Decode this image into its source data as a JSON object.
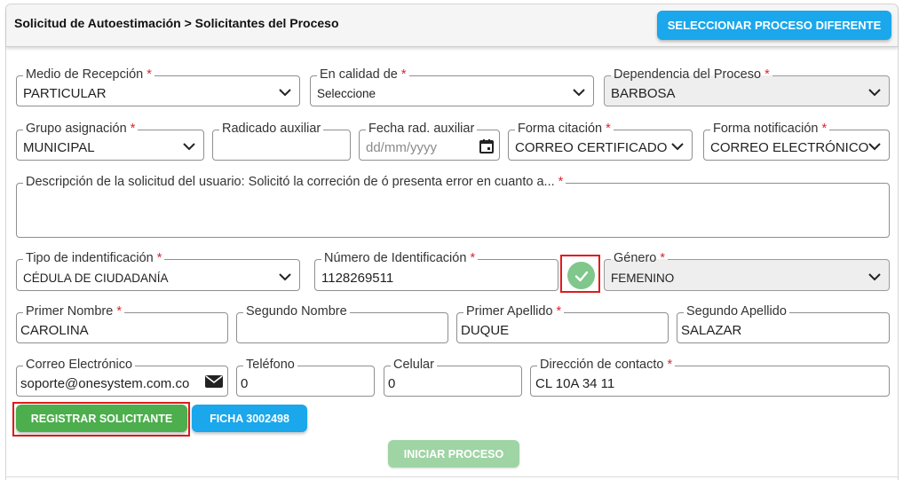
{
  "header": {
    "breadcrumb": "Solicitud de Autoestimación > Solicitantes del Proceso",
    "select_other_process": "SELECCIONAR PROCESO DIFERENTE"
  },
  "form": {
    "medio_recepcion": {
      "label": "Medio de Recepción",
      "required": "*",
      "value": "PARTICULAR"
    },
    "en_calidad_de": {
      "label": "En calidad de",
      "required": "*",
      "value": "Seleccione"
    },
    "dependencia_proceso": {
      "label": "Dependencia del Proceso",
      "required": "*",
      "value": "BARBOSA"
    },
    "grupo_asignacion": {
      "label": "Grupo asignación",
      "required": "*",
      "value": "MUNICIPAL"
    },
    "radicado_auxiliar": {
      "label": "Radicado auxiliar",
      "value": ""
    },
    "fecha_rad_auxiliar": {
      "label": "Fecha rad. auxiliar",
      "placeholder": "dd/mm/yyyy"
    },
    "forma_citacion": {
      "label": "Forma citación",
      "required": "*",
      "value": "CORREO CERTIFICADO"
    },
    "forma_notificacion": {
      "label": "Forma notificación",
      "required": "*",
      "value": "CORREO ELECTRÓNICO"
    },
    "descripcion": {
      "label": "Descripción de la solicitud del usuario: Solicitó la correción de ó presenta error en cuanto a...",
      "required": "*",
      "value": ""
    },
    "tipo_identificacion": {
      "label": "Tipo de indentificación",
      "required": "*",
      "value": "CÉDULA DE CIUDADANÍA"
    },
    "numero_identificacion": {
      "label": "Número de Identificación",
      "required": "*",
      "value": "1128269511"
    },
    "genero": {
      "label": "Género",
      "required": "*",
      "value": "FEMENINO"
    },
    "primer_nombre": {
      "label": "Primer Nombre",
      "required": "*",
      "value": "CAROLINA"
    },
    "segundo_nombre": {
      "label": "Segundo Nombre",
      "value": ""
    },
    "primer_apellido": {
      "label": "Primer Apellido",
      "required": "*",
      "value": "DUQUE"
    },
    "segundo_apellido": {
      "label": "Segundo Apellido",
      "value": "SALAZAR"
    },
    "correo": {
      "label": "Correo Electrónico",
      "value": "soporte@onesystem.com.co"
    },
    "telefono": {
      "label": "Teléfono",
      "value": "0"
    },
    "celular": {
      "label": "Celular",
      "value": "0"
    },
    "direccion": {
      "label": "Dirección de contacto",
      "required": "*",
      "value": "CL 10A 34 11"
    }
  },
  "actions": {
    "registrar": "REGISTRAR SOLICITANTE",
    "ficha": "FICHA 3002498",
    "iniciar": "INICIAR PROCESO"
  },
  "colors": {
    "blue": "#1aa7ec",
    "green": "#4cae4c",
    "green_disabled": "#9fd4a4",
    "required": "#d9262c",
    "highlight": "#e01b1b"
  },
  "icons": {
    "select": "chevron-down-icon",
    "calendar": "calendar-icon",
    "envelope": "envelope-icon",
    "verified": "check-circle-icon"
  }
}
